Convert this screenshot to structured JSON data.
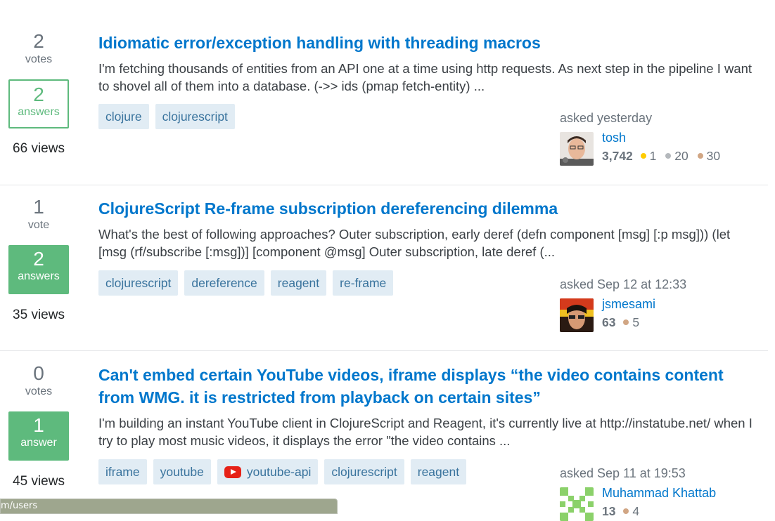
{
  "questions": [
    {
      "votes": "2",
      "votes_label": "votes",
      "answers": "2",
      "answers_label": "answers",
      "views": "66 views",
      "title": "Idiomatic error/exception handling with threading macros",
      "excerpt": "I'm fetching thousands of entities from an API one at a time using http requests. As next step in the pipeline I want to shovel all of them into a database. (->> ids (pmap fetch-entity) ...",
      "tags": [
        "clojure",
        "clojurescript"
      ],
      "asked": "asked yesterday",
      "user": "tosh",
      "rep": "3,742",
      "gold": "1",
      "silver": "20",
      "bronze": "30"
    },
    {
      "votes": "1",
      "votes_label": "vote",
      "answers": "2",
      "answers_label": "answers",
      "views": "35 views",
      "title": "ClojureScript Re-frame subscription dereferencing dilemma",
      "excerpt": "What's the best of following approaches? Outer subscription, early deref (defn component [msg] [:p msg])) (let [msg (rf/subscribe [:msg])] [component @msg] Outer subscription, late deref (...",
      "tags": [
        "clojurescript",
        "dereference",
        "reagent",
        "re-frame"
      ],
      "asked": "asked Sep 12 at 12:33",
      "user": "jsmesami",
      "rep": "63",
      "bronze": "5"
    },
    {
      "votes": "0",
      "votes_label": "votes",
      "answers": "1",
      "answers_label": "answer",
      "views": "45 views",
      "title": "Can't embed certain YouTube videos, iframe displays “the video contains content from WMG. it is restricted from playback on certain sites”",
      "excerpt": "I'm building an instant YouTube client in ClojureScript and Reagent, it's currently live at http://instatube.net/ when I try to play most music videos, it displays the error \"the video contains ...",
      "tags": [
        "iframe",
        "youtube",
        "youtube-api",
        "clojurescript",
        "reagent"
      ],
      "asked": "asked Sep 11 at 19:53",
      "user": "Muhammad Khattab",
      "rep": "13",
      "bronze": "4"
    }
  ],
  "status_bar": {
    "url": "m/users"
  },
  "colors": {
    "link": "#0077cc",
    "answered": "#5eba7d",
    "tag_bg": "#e1ecf4",
    "tag_text": "#39739d"
  },
  "icons": {
    "youtube_tag": "youtube-icon"
  }
}
